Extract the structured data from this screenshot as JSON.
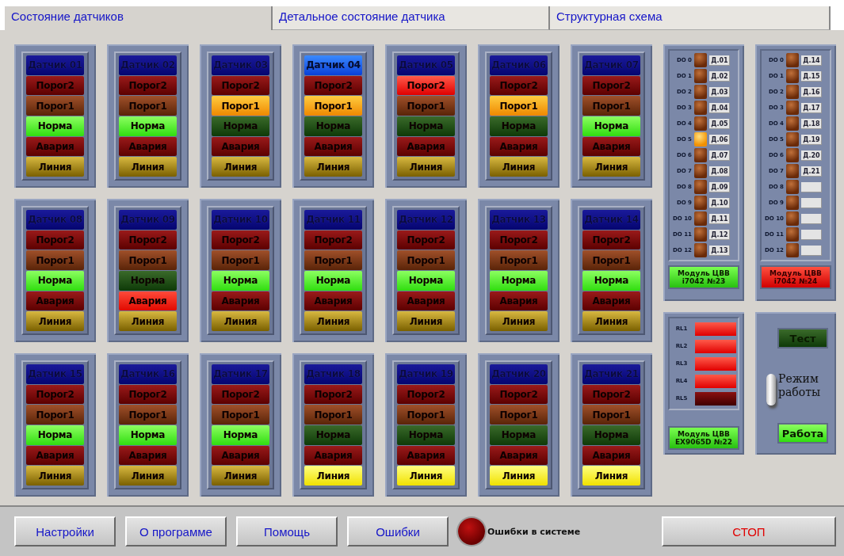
{
  "tabs": [
    {
      "label": "Состояние датчиков",
      "selected": true
    },
    {
      "label": "Детальное состояние датчика",
      "selected": false
    },
    {
      "label": "Структурная схема",
      "selected": false
    }
  ],
  "sensors": [
    {
      "title": "Датчик 01",
      "on": false,
      "lamps": [
        {
          "kind": "threshold2",
          "label": "Порог2",
          "on": false
        },
        {
          "kind": "threshold1",
          "label": "Порог1",
          "on": false
        },
        {
          "kind": "normal",
          "label": "Норма",
          "on": true
        },
        {
          "kind": "alarm",
          "label": "Авария",
          "on": false
        },
        {
          "kind": "line",
          "label": "Линия",
          "on": false
        }
      ]
    },
    {
      "title": "Датчик 02",
      "on": false,
      "lamps": [
        {
          "kind": "threshold2",
          "label": "Порог2",
          "on": false
        },
        {
          "kind": "threshold1",
          "label": "Порог1",
          "on": false
        },
        {
          "kind": "normal",
          "label": "Норма",
          "on": true
        },
        {
          "kind": "alarm",
          "label": "Авария",
          "on": false
        },
        {
          "kind": "line",
          "label": "Линия",
          "on": false
        }
      ]
    },
    {
      "title": "Датчик 03",
      "on": false,
      "lamps": [
        {
          "kind": "threshold2",
          "label": "Порог2",
          "on": false
        },
        {
          "kind": "threshold1",
          "label": "Порог1",
          "on": true
        },
        {
          "kind": "normal",
          "label": "Норма",
          "on": false
        },
        {
          "kind": "alarm",
          "label": "Авария",
          "on": false
        },
        {
          "kind": "line",
          "label": "Линия",
          "on": false
        }
      ]
    },
    {
      "title": "Датчик 04",
      "on": true,
      "lamps": [
        {
          "kind": "threshold2",
          "label": "Порог2",
          "on": false
        },
        {
          "kind": "threshold1",
          "label": "Порог1",
          "on": true
        },
        {
          "kind": "normal",
          "label": "Норма",
          "on": false
        },
        {
          "kind": "alarm",
          "label": "Авария",
          "on": false
        },
        {
          "kind": "line",
          "label": "Линия",
          "on": false
        }
      ]
    },
    {
      "title": "Датчик 05",
      "on": false,
      "lamps": [
        {
          "kind": "threshold2",
          "label": "Порог2",
          "on": true
        },
        {
          "kind": "threshold1",
          "label": "Порог1",
          "on": false
        },
        {
          "kind": "normal",
          "label": "Норма",
          "on": false
        },
        {
          "kind": "alarm",
          "label": "Авария",
          "on": false
        },
        {
          "kind": "line",
          "label": "Линия",
          "on": false
        }
      ]
    },
    {
      "title": "Датчик 06",
      "on": false,
      "lamps": [
        {
          "kind": "threshold2",
          "label": "Порог2",
          "on": false
        },
        {
          "kind": "threshold1",
          "label": "Порог1",
          "on": true
        },
        {
          "kind": "normal",
          "label": "Норма",
          "on": false
        },
        {
          "kind": "alarm",
          "label": "Авария",
          "on": false
        },
        {
          "kind": "line",
          "label": "Линия",
          "on": false
        }
      ]
    },
    {
      "title": "Датчик 07",
      "on": false,
      "lamps": [
        {
          "kind": "threshold2",
          "label": "Порог2",
          "on": false
        },
        {
          "kind": "threshold1",
          "label": "Порог1",
          "on": false
        },
        {
          "kind": "normal",
          "label": "Норма",
          "on": true
        },
        {
          "kind": "alarm",
          "label": "Авария",
          "on": false
        },
        {
          "kind": "line",
          "label": "Линия",
          "on": false
        }
      ]
    },
    {
      "title": "Датчик 08",
      "on": false,
      "lamps": [
        {
          "kind": "threshold2",
          "label": "Порог2",
          "on": false
        },
        {
          "kind": "threshold1",
          "label": "Порог1",
          "on": false
        },
        {
          "kind": "normal",
          "label": "Норма",
          "on": true
        },
        {
          "kind": "alarm",
          "label": "Авария",
          "on": false
        },
        {
          "kind": "line",
          "label": "Линия",
          "on": false
        }
      ]
    },
    {
      "title": "Датчик 09",
      "on": false,
      "lamps": [
        {
          "kind": "threshold2",
          "label": "Порог2",
          "on": false
        },
        {
          "kind": "threshold1",
          "label": "Порог1",
          "on": false
        },
        {
          "kind": "normal",
          "label": "Норма",
          "on": false
        },
        {
          "kind": "alarm",
          "label": "Авария",
          "on": true
        },
        {
          "kind": "line",
          "label": "Линия",
          "on": false
        }
      ]
    },
    {
      "title": "Датчик 10",
      "on": false,
      "lamps": [
        {
          "kind": "threshold2",
          "label": "Порог2",
          "on": false
        },
        {
          "kind": "threshold1",
          "label": "Порог1",
          "on": false
        },
        {
          "kind": "normal",
          "label": "Норма",
          "on": true
        },
        {
          "kind": "alarm",
          "label": "Авария",
          "on": false
        },
        {
          "kind": "line",
          "label": "Линия",
          "on": false
        }
      ]
    },
    {
      "title": "Датчик 11",
      "on": false,
      "lamps": [
        {
          "kind": "threshold2",
          "label": "Порог2",
          "on": false
        },
        {
          "kind": "threshold1",
          "label": "Порог1",
          "on": false
        },
        {
          "kind": "normal",
          "label": "Норма",
          "on": true
        },
        {
          "kind": "alarm",
          "label": "Авария",
          "on": false
        },
        {
          "kind": "line",
          "label": "Линия",
          "on": false
        }
      ]
    },
    {
      "title": "Датчик 12",
      "on": false,
      "lamps": [
        {
          "kind": "threshold2",
          "label": "Порог2",
          "on": false
        },
        {
          "kind": "threshold1",
          "label": "Порог1",
          "on": false
        },
        {
          "kind": "normal",
          "label": "Норма",
          "on": true
        },
        {
          "kind": "alarm",
          "label": "Авария",
          "on": false
        },
        {
          "kind": "line",
          "label": "Линия",
          "on": false
        }
      ]
    },
    {
      "title": "Датчик 13",
      "on": false,
      "lamps": [
        {
          "kind": "threshold2",
          "label": "Порог2",
          "on": false
        },
        {
          "kind": "threshold1",
          "label": "Порог1",
          "on": false
        },
        {
          "kind": "normal",
          "label": "Норма",
          "on": true
        },
        {
          "kind": "alarm",
          "label": "Авария",
          "on": false
        },
        {
          "kind": "line",
          "label": "Линия",
          "on": false
        }
      ]
    },
    {
      "title": "Датчик 14",
      "on": false,
      "lamps": [
        {
          "kind": "threshold2",
          "label": "Порог2",
          "on": false
        },
        {
          "kind": "threshold1",
          "label": "Порог1",
          "on": false
        },
        {
          "kind": "normal",
          "label": "Норма",
          "on": true
        },
        {
          "kind": "alarm",
          "label": "Авария",
          "on": false
        },
        {
          "kind": "line",
          "label": "Линия",
          "on": false
        }
      ]
    },
    {
      "title": "Датчик 15",
      "on": false,
      "lamps": [
        {
          "kind": "threshold2",
          "label": "Порог2",
          "on": false
        },
        {
          "kind": "threshold1",
          "label": "Порог1",
          "on": false
        },
        {
          "kind": "normal",
          "label": "Норма",
          "on": true
        },
        {
          "kind": "alarm",
          "label": "Авария",
          "on": false
        },
        {
          "kind": "line",
          "label": "Линия",
          "on": false
        }
      ]
    },
    {
      "title": "Датчик 16",
      "on": false,
      "lamps": [
        {
          "kind": "threshold2",
          "label": "Порог2",
          "on": false
        },
        {
          "kind": "threshold1",
          "label": "Порог1",
          "on": false
        },
        {
          "kind": "normal",
          "label": "Норма",
          "on": true
        },
        {
          "kind": "alarm",
          "label": "Авария",
          "on": false
        },
        {
          "kind": "line",
          "label": "Линия",
          "on": false
        }
      ]
    },
    {
      "title": "Датчик 17",
      "on": false,
      "lamps": [
        {
          "kind": "threshold2",
          "label": "Порог2",
          "on": false
        },
        {
          "kind": "threshold1",
          "label": "Порог1",
          "on": false
        },
        {
          "kind": "normal",
          "label": "Норма",
          "on": true
        },
        {
          "kind": "alarm",
          "label": "Авария",
          "on": false
        },
        {
          "kind": "line",
          "label": "Линия",
          "on": false
        }
      ]
    },
    {
      "title": "Датчик 18",
      "on": false,
      "lamps": [
        {
          "kind": "threshold2",
          "label": "Порог2",
          "on": false
        },
        {
          "kind": "threshold1",
          "label": "Порог1",
          "on": false
        },
        {
          "kind": "normal",
          "label": "Норма",
          "on": false
        },
        {
          "kind": "alarm",
          "label": "Авария",
          "on": false
        },
        {
          "kind": "line",
          "label": "Линия",
          "on": true
        }
      ]
    },
    {
      "title": "Датчик 19",
      "on": false,
      "lamps": [
        {
          "kind": "threshold2",
          "label": "Порог2",
          "on": false
        },
        {
          "kind": "threshold1",
          "label": "Порог1",
          "on": false
        },
        {
          "kind": "normal",
          "label": "Норма",
          "on": false
        },
        {
          "kind": "alarm",
          "label": "Авария",
          "on": false
        },
        {
          "kind": "line",
          "label": "Линия",
          "on": true
        }
      ]
    },
    {
      "title": "Датчик 20",
      "on": false,
      "lamps": [
        {
          "kind": "threshold2",
          "label": "Порог2",
          "on": false
        },
        {
          "kind": "threshold1",
          "label": "Порог1",
          "on": false
        },
        {
          "kind": "normal",
          "label": "Норма",
          "on": false
        },
        {
          "kind": "alarm",
          "label": "Авария",
          "on": false
        },
        {
          "kind": "line",
          "label": "Линия",
          "on": true
        }
      ]
    },
    {
      "title": "Датчик 21",
      "on": false,
      "lamps": [
        {
          "kind": "threshold2",
          "label": "Порог2",
          "on": false
        },
        {
          "kind": "threshold1",
          "label": "Порог1",
          "on": false
        },
        {
          "kind": "normal",
          "label": "Норма",
          "on": false
        },
        {
          "kind": "alarm",
          "label": "Авария",
          "on": false
        },
        {
          "kind": "line",
          "label": "Линия",
          "on": true
        }
      ]
    }
  ],
  "output_modules": [
    {
      "outputs": [
        {
          "name": "DO 0",
          "on": false,
          "tag": "Д.01"
        },
        {
          "name": "DO 1",
          "on": false,
          "tag": "Д.02"
        },
        {
          "name": "DO 2",
          "on": false,
          "tag": "Д.03"
        },
        {
          "name": "DO 3",
          "on": false,
          "tag": "Д.04"
        },
        {
          "name": "DO 4",
          "on": false,
          "tag": "Д.05"
        },
        {
          "name": "DO 5",
          "on": true,
          "tag": "Д.06"
        },
        {
          "name": "DO 6",
          "on": false,
          "tag": "Д.07"
        },
        {
          "name": "DO 7",
          "on": false,
          "tag": "Д.08"
        },
        {
          "name": "DO 8",
          "on": false,
          "tag": "Д.09"
        },
        {
          "name": "DO 9",
          "on": false,
          "tag": "Д.10"
        },
        {
          "name": "DO 10",
          "on": false,
          "tag": "Д.11"
        },
        {
          "name": "DO 11",
          "on": false,
          "tag": "Д.12"
        },
        {
          "name": "DO 12",
          "on": false,
          "tag": "Д.13"
        }
      ],
      "module": {
        "lines": [
          "Модуль ЦВВ",
          "i7042 №23"
        ],
        "ok": true
      }
    },
    {
      "outputs": [
        {
          "name": "DO 0",
          "on": false,
          "tag": "Д.14"
        },
        {
          "name": "DO 1",
          "on": false,
          "tag": "Д.15"
        },
        {
          "name": "DO 2",
          "on": false,
          "tag": "Д.16"
        },
        {
          "name": "DO 3",
          "on": false,
          "tag": "Д.17"
        },
        {
          "name": "DO 4",
          "on": false,
          "tag": "Д.18"
        },
        {
          "name": "DO 5",
          "on": false,
          "tag": "Д.19"
        },
        {
          "name": "DO 6",
          "on": false,
          "tag": "Д.20"
        },
        {
          "name": "DO 7",
          "on": false,
          "tag": "Д.21"
        },
        {
          "name": "DO 8",
          "on": false
        },
        {
          "name": "DO 9",
          "on": false
        },
        {
          "name": "DO 10",
          "on": false
        },
        {
          "name": "DO 11",
          "on": false
        },
        {
          "name": "DO 12",
          "on": false
        }
      ],
      "module": {
        "lines": [
          "Модуль ЦВВ",
          "i7042 №24"
        ],
        "ok": false
      }
    }
  ],
  "relay_module": {
    "relays": [
      {
        "name": "RL1",
        "on": true
      },
      {
        "name": "RL2",
        "on": true
      },
      {
        "name": "RL3",
        "on": true
      },
      {
        "name": "RL4",
        "on": true
      },
      {
        "name": "RL5",
        "on": false
      }
    ],
    "module": {
      "lines": [
        "Модуль ЦВВ",
        "EX9065D №22"
      ],
      "ok": true
    }
  },
  "mode_panel": {
    "test": {
      "label": "Тест",
      "on": false
    },
    "label": "Режим работы",
    "switch": {
      "on": true
    },
    "work": {
      "label": "Работа",
      "on": true
    }
  },
  "bottom_bar": {
    "buttons": [
      "Настройки",
      "О программе",
      "Помощь",
      "Ошибки"
    ],
    "error_led": {
      "on": false,
      "label": "Ошибки в системе"
    },
    "stop": "СТОП"
  }
}
